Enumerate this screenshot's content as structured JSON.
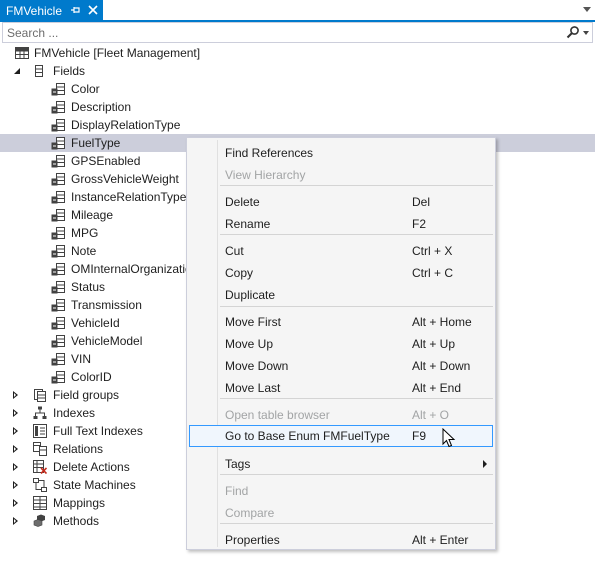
{
  "tab": {
    "title": "FMVehicle",
    "pin_glyph": "⊸"
  },
  "search": {
    "placeholder": "Search ..."
  },
  "tree": {
    "root": {
      "label": "FMVehicle [Fleet Management]"
    },
    "fields_node": {
      "label": "Fields"
    },
    "fields": [
      "Color",
      "Description",
      "DisplayRelationType",
      "FuelType",
      "GPSEnabled",
      "GrossVehicleWeight",
      "InstanceRelationType",
      "Mileage",
      "MPG",
      "Note",
      "OMInternalOrganization",
      "Status",
      "Transmission",
      "VehicleId",
      "VehicleModel",
      "VIN",
      "ColorID"
    ],
    "selected_field": "FuelType",
    "groups": [
      {
        "label": "Field groups",
        "icon": "field-groups-icon"
      },
      {
        "label": "Indexes",
        "icon": "indexes-icon"
      },
      {
        "label": "Full Text Indexes",
        "icon": "full-text-indexes-icon"
      },
      {
        "label": "Relations",
        "icon": "relations-icon"
      },
      {
        "label": "Delete Actions",
        "icon": "delete-actions-icon"
      },
      {
        "label": "State Machines",
        "icon": "state-machines-icon"
      },
      {
        "label": "Mappings",
        "icon": "mappings-icon"
      },
      {
        "label": "Methods",
        "icon": "methods-icon"
      }
    ]
  },
  "context_menu": {
    "items": [
      {
        "label": "Find References",
        "shortcut": "",
        "disabled": false
      },
      {
        "label": "View Hierarchy",
        "shortcut": "",
        "disabled": true
      },
      {
        "label": "Delete",
        "shortcut": "Del",
        "disabled": false
      },
      {
        "label": "Rename",
        "shortcut": "F2",
        "disabled": false
      },
      {
        "label": "Cut",
        "shortcut": "Ctrl + X",
        "disabled": false
      },
      {
        "label": "Copy",
        "shortcut": "Ctrl + C",
        "disabled": false
      },
      {
        "label": "Duplicate",
        "shortcut": "",
        "disabled": false
      },
      {
        "label": "Move First",
        "shortcut": "Alt + Home",
        "disabled": false
      },
      {
        "label": "Move Up",
        "shortcut": "Alt + Up",
        "disabled": false
      },
      {
        "label": "Move Down",
        "shortcut": "Alt + Down",
        "disabled": false
      },
      {
        "label": "Move Last",
        "shortcut": "Alt + End",
        "disabled": false
      },
      {
        "label": "Open table browser",
        "shortcut": "Alt + O",
        "disabled": true
      },
      {
        "label": "Go to Base Enum FMFuelType",
        "shortcut": "F9",
        "disabled": false,
        "hovered": true
      },
      {
        "label": "Tags",
        "shortcut": "",
        "disabled": false,
        "submenu": true
      },
      {
        "label": "Find",
        "shortcut": "",
        "disabled": true
      },
      {
        "label": "Compare",
        "shortcut": "",
        "disabled": true
      },
      {
        "label": "Properties",
        "shortcut": "Alt + Enter",
        "disabled": false
      }
    ]
  },
  "colors": {
    "accent": "#007acc",
    "selection": "#cccedb",
    "menu_background": "#f5f5f5",
    "menu_hover_border": "#3399ff",
    "disabled_text": "#a2a4a5"
  }
}
